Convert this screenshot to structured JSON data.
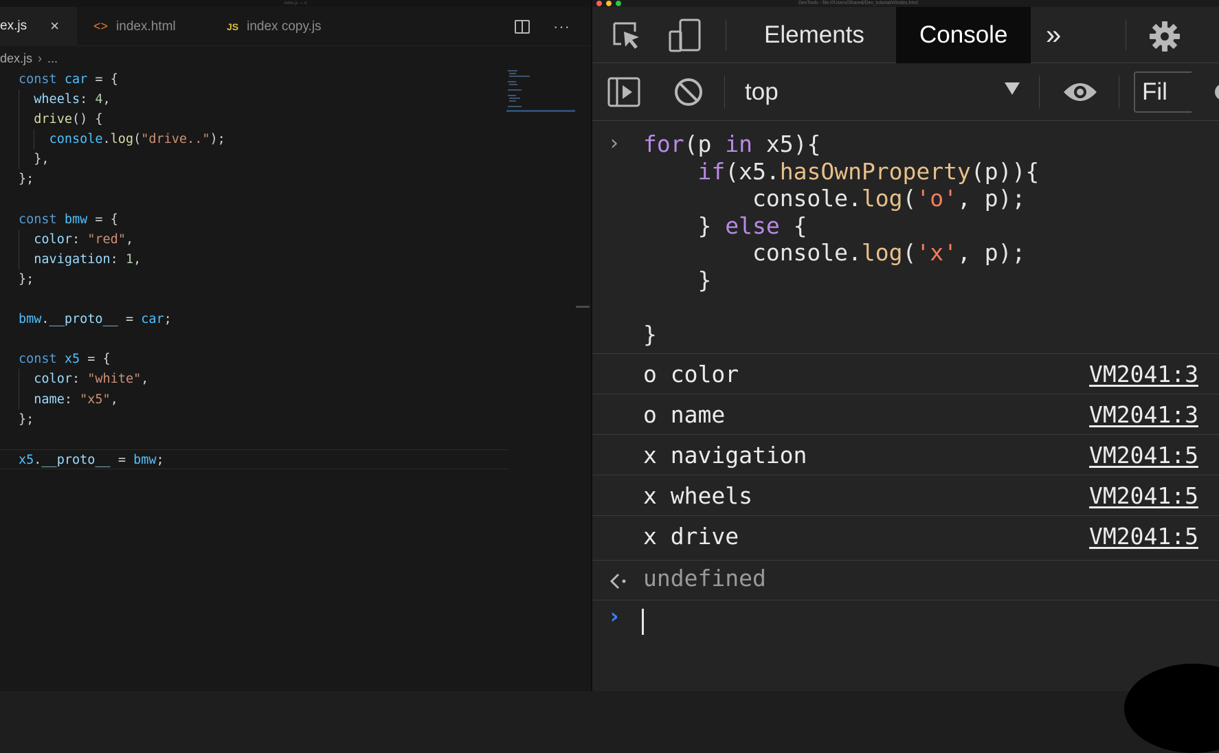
{
  "editor": {
    "window_title": "index.js — rt",
    "tabs": [
      {
        "lang": "",
        "label": "ex.js",
        "active": true
      },
      {
        "lang": "<>",
        "label": "index.html",
        "active": false
      },
      {
        "lang": "JS",
        "label": "index copy.js",
        "active": false
      }
    ],
    "close_glyph": "×",
    "breadcrumb": {
      "file": "dex.js",
      "sep": "›",
      "rest": "..."
    },
    "code_lines": [
      "const car = {",
      "  wheels: 4,",
      "  drive() {",
      "    console.log(\"drive..\");",
      "  },",
      "};",
      "",
      "const bmw = {",
      "  color: \"red\",",
      "  navigation: 1,",
      "};",
      "",
      "bmw.__proto__ = car;",
      "",
      "const x5 = {",
      "  color: \"white\",",
      "  name: \"x5\",",
      "};",
      "",
      "x5.__proto__ = bmw;"
    ]
  },
  "devtools": {
    "window_title": "DevTools - file:///Users/Shared/Dev_tutorial/rt/index.html",
    "tabs": {
      "elements": "Elements",
      "console": "Console",
      "more": "»"
    },
    "context": "top",
    "filter_placeholder": "Fil",
    "console_input": [
      "for(p in x5){",
      "    if(x5.hasOwnProperty(p)){",
      "        console.log('o', p);",
      "    } else {",
      "        console.log('x', p);",
      "    }",
      "",
      "}"
    ],
    "logs": [
      {
        "text": "o color",
        "source": "VM2041:3"
      },
      {
        "text": "o name",
        "source": "VM2041:3"
      },
      {
        "text": "x navigation",
        "source": "VM2041:5"
      },
      {
        "text": "x wheels",
        "source": "VM2041:5"
      },
      {
        "text": "x drive",
        "source": "VM2041:5"
      }
    ],
    "result": "undefined",
    "colors": {
      "active_tab_bg": "#0c0c0c",
      "prompt_accent": "#3b82f6"
    }
  }
}
